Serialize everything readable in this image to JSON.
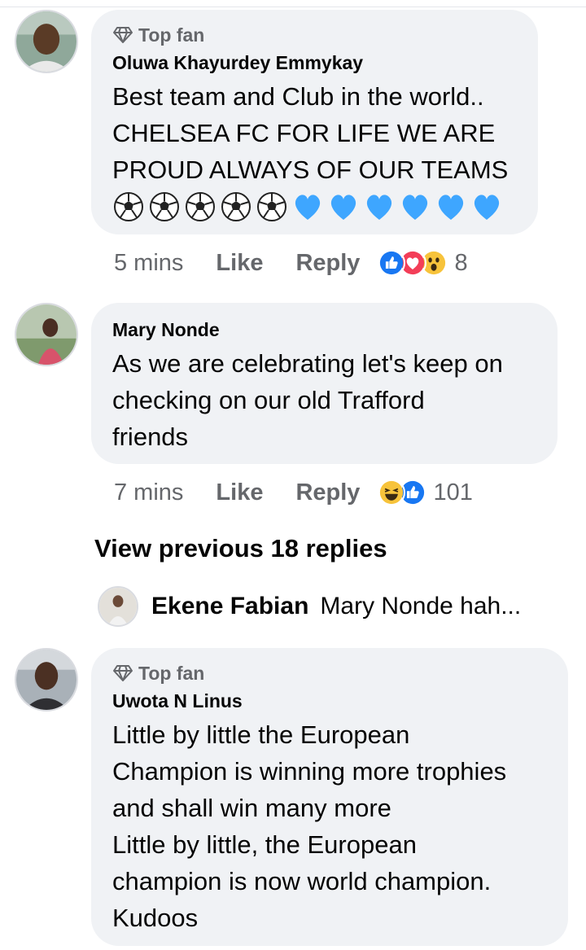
{
  "comments": [
    {
      "badge": "Top fan",
      "author": "Oluwa Khayurdey Emmykay",
      "text": "Best team and Club in the world..\nCHELSEA FC FOR LIFE WE ARE\nPROUD ALWAYS OF OUR TEAMS",
      "emojis": [
        "soccer-ball",
        "soccer-ball",
        "soccer-ball",
        "soccer-ball",
        "soccer-ball",
        "blue-heart",
        "blue-heart",
        "blue-heart",
        "blue-heart",
        "blue-heart",
        "blue-heart"
      ],
      "time": "5 mins",
      "like_label": "Like",
      "reply_label": "Reply",
      "reactions": [
        "like",
        "love",
        "wow"
      ],
      "reaction_count": "8"
    },
    {
      "author": "Mary Nonde",
      "text": "As we are celebrating let's keep on\nchecking on our old Trafford\nfriends",
      "time": "7 mins",
      "like_label": "Like",
      "reply_label": "Reply",
      "reactions": [
        "haha",
        "like"
      ],
      "reaction_count": "101"
    },
    {
      "badge": "Top fan",
      "author": "Uwota N Linus",
      "text": "Little by little the European\nChampion is winning more trophies\nand shall win many more\nLittle by little, the European\nchampion is now world champion.\nKudoos"
    }
  ],
  "view_previous": "View previous 18 replies",
  "latest_reply": {
    "author": "Ekene Fabian",
    "snippet": "Mary Nonde hah..."
  },
  "colors": {
    "bubble": "#f0f2f5",
    "muted": "#65676b",
    "like_blue": "#1877f2",
    "love_red": "#f33e58",
    "heart_blue": "#3ea6ff"
  }
}
